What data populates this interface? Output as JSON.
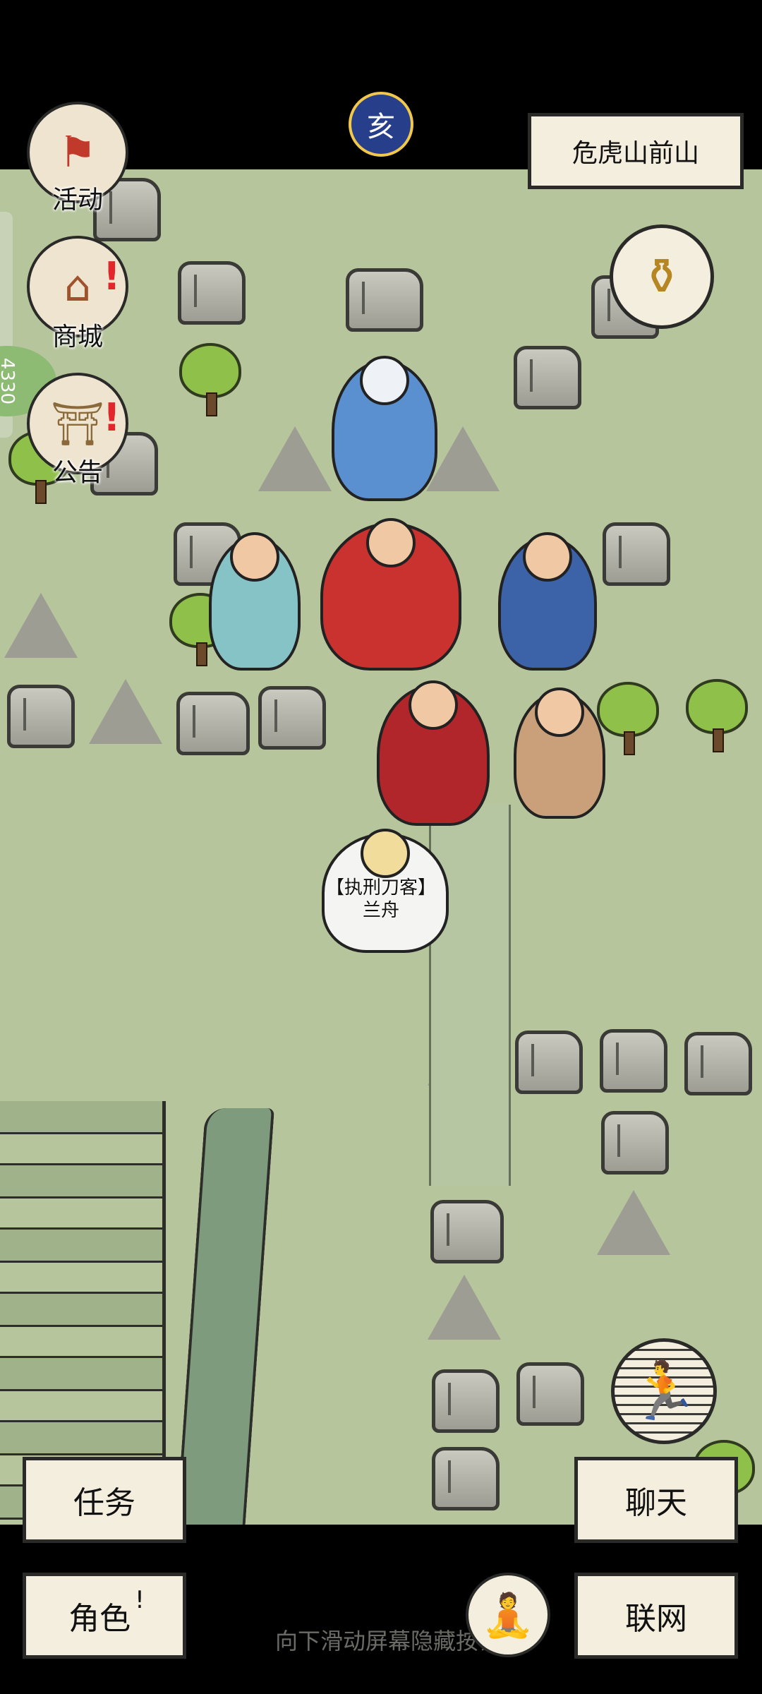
{
  "location": {
    "name": "危虎山前山"
  },
  "time_icon": {
    "glyph": "亥"
  },
  "side_menu": [
    {
      "id": "activity",
      "label": "活动",
      "icon": "banner-icon",
      "has_alert": false
    },
    {
      "id": "shop",
      "label": "商城",
      "icon": "shop-icon",
      "has_alert": true
    },
    {
      "id": "notice",
      "label": "公告",
      "icon": "notice-icon",
      "has_alert": true
    }
  ],
  "alert_mark": "!",
  "npc": {
    "title": "【执刑刀客】",
    "name": "兰舟"
  },
  "buttons": {
    "task": "任务",
    "chat": "聊天",
    "role": "角色",
    "network": "联网"
  },
  "hint": "向下滑动屏幕隐藏按钮",
  "side_progress": "4330",
  "icons": {
    "treasure": "censer-icon",
    "run": "running-figure-icon",
    "meditate": "meditating-figure-icon"
  }
}
